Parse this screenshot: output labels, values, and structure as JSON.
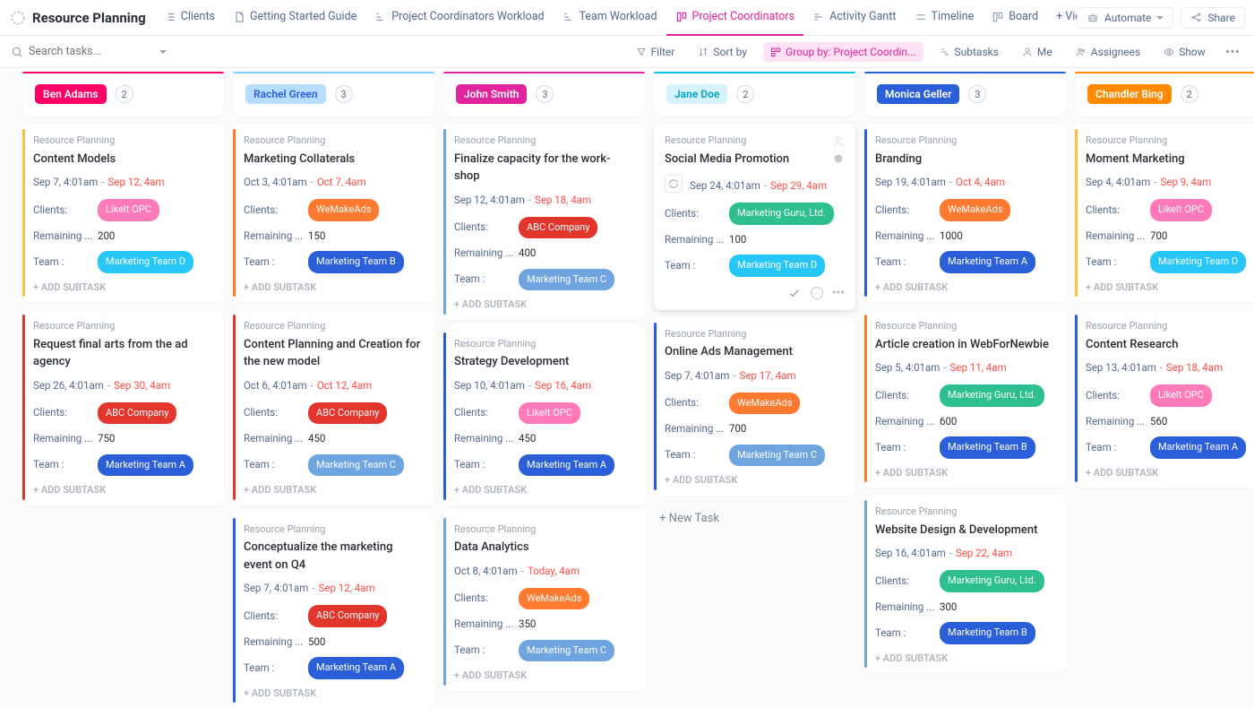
{
  "header": {
    "title": "Resource Planning",
    "tabs": [
      {
        "label": "Clients",
        "icon": "list"
      },
      {
        "label": "Getting Started Guide",
        "icon": "doc"
      },
      {
        "label": "Project Coordinators Workload",
        "icon": "workload"
      },
      {
        "label": "Team Workload",
        "icon": "workload"
      },
      {
        "label": "Project Coordinators",
        "icon": "board",
        "active": true
      },
      {
        "label": "Activity Gantt",
        "icon": "gantt"
      },
      {
        "label": "Timeline",
        "icon": "timeline"
      },
      {
        "label": "Board",
        "icon": "board"
      },
      {
        "label": "+ View",
        "icon": ""
      }
    ],
    "automate": "Automate",
    "share": "Share"
  },
  "filters": {
    "search_placeholder": "Search tasks...",
    "filter": "Filter",
    "sortby": "Sort by",
    "groupby": "Group by: Project Coordin...",
    "subtasks": "Subtasks",
    "me": "Me",
    "assignees": "Assignees",
    "show": "Show"
  },
  "labels": {
    "project": "Resource Planning",
    "clients": "Clients:",
    "remaining": "Remaining ...",
    "team": "Team :",
    "addsub": "+ ADD SUBTASK",
    "newtask": "+ New Task"
  },
  "tag_colors": {
    "LikeIt OPC": "#ff7ab8",
    "WeMakeAds": "#ff7a2f",
    "ABC Company": "#e2362c",
    "Marketing Guru, Ltd.": "#2dc08d",
    "Marketing Team A": "#2b5fd9",
    "Marketing Team B": "#2b5fd9",
    "Marketing Team C": "#6ea4df",
    "Marketing Team D": "#26c6f9"
  },
  "columns": [
    {
      "name": "Ben Adams",
      "count": 2,
      "strip": "#ff0066",
      "badge_bg": "#ff0066",
      "badge_fg": "#ffffff",
      "cards": [
        {
          "strip": "#f5c242",
          "title": "Content Models",
          "d1": "Sep 7, 4:01am",
          "d2": "Sep 12, 4am",
          "client": "LikeIt OPC",
          "remaining": "200",
          "team": "Marketing Team D"
        },
        {
          "strip": "#e2362c",
          "title": "Request final arts from the ad agency",
          "d1": "Sep 26, 4:01am",
          "d2": "Sep 30, 4am",
          "client": "ABC Company",
          "remaining": "750",
          "team": "Marketing Team A"
        }
      ]
    },
    {
      "name": "Rachel Green",
      "count": 3,
      "strip": "#7fd4ff",
      "badge_bg": "#b7ddff",
      "badge_fg": "#2b5fd9",
      "cards": [
        {
          "strip": "#ff7a2f",
          "title": "Marketing Collaterals",
          "d1": "Oct 3, 4:01am",
          "d2": "Oct 7, 4am",
          "client": "WeMakeAds",
          "remaining": "150",
          "team": "Marketing Team B"
        },
        {
          "strip": "#e2362c",
          "title": "Content Planning and Creation for the new model",
          "d1": "Oct 6, 4:01am",
          "d2": "Oct 12, 4am",
          "client": "ABC Company",
          "remaining": "450",
          "team": "Marketing Team C"
        },
        {
          "strip": "#2b5fd9",
          "title": "Conceptualize the marketing event on Q4",
          "d1": "Sep 7, 4:01am",
          "d2": "Sep 12, 4am",
          "client": "ABC Company",
          "remaining": "500",
          "team": "Marketing Team A"
        }
      ]
    },
    {
      "name": "John Smith",
      "count": 3,
      "strip": "#e2239e",
      "badge_bg": "#e2239e",
      "badge_fg": "#ffffff",
      "cards": [
        {
          "strip": "#6ea4df",
          "title": "Finalize capacity for the work-shop",
          "d1": "Sep 12, 4:01am",
          "d2": "Sep 18, 4am",
          "client": "ABC Company",
          "remaining": "400",
          "team": "Marketing Team C"
        },
        {
          "strip": "#2b5fd9",
          "title": "Strategy Development",
          "d1": "Sep 10, 4:01am",
          "d2": "Sep 16, 4am",
          "client": "LikeIt OPC",
          "remaining": "450",
          "team": "Marketing Team A"
        },
        {
          "strip": "#6ea4df",
          "title": "Data Analytics",
          "d1": "Oct 8, 4:01am",
          "d2": "Today, 4am",
          "client": "WeMakeAds",
          "remaining": "350",
          "team": "Marketing Team C"
        }
      ]
    },
    {
      "name": "Jane Doe",
      "count": 2,
      "strip": "#00c4e8",
      "badge_bg": "#d5f3f8",
      "badge_fg": "#00a3c4",
      "cards": [
        {
          "strip": "#ffffff",
          "hover": true,
          "recur": true,
          "title": "Social Media Promotion",
          "d1": "Sep 24, 4:01am",
          "d2": "Sep 29, 4am",
          "client": "Marketing Guru, Ltd.",
          "remaining": "100",
          "team": "Marketing Team D"
        },
        {
          "strip": "#2b5fd9",
          "title": "Online Ads Management",
          "d1": "Sep 7, 4:01am",
          "d2": "Sep 17, 4am",
          "client": "WeMakeAds",
          "remaining": "700",
          "team": "Marketing Team C"
        }
      ],
      "show_new_task": true
    },
    {
      "name": "Monica Geller",
      "count": 3,
      "strip": "#2b5fd9",
      "badge_bg": "#2b5fd9",
      "badge_fg": "#ffffff",
      "cards": [
        {
          "strip": "#2b5fd9",
          "title": "Branding",
          "d1": "Sep 19, 4:01am",
          "d2": "Oct 4, 4am",
          "client": "WeMakeAds",
          "remaining": "1000",
          "team": "Marketing Team A"
        },
        {
          "strip": "#ff7a2f",
          "title": "Article creation in WebForNewbie",
          "d1": "Sep 5, 4:01am",
          "d2": "Sep 11, 4am",
          "client": "Marketing Guru, Ltd.",
          "remaining": "600",
          "team": "Marketing Team B"
        },
        {
          "strip": "#6ea4df",
          "title": "Website Design & Development",
          "d1": "Sep 16, 4:01am",
          "d2": "Sep 22, 4am",
          "client": "Marketing Guru, Ltd.",
          "remaining": "300",
          "team": "Marketing Team B"
        }
      ]
    },
    {
      "name": "Chandler Bing",
      "count": 2,
      "strip": "#ff8a00",
      "badge_bg": "#ff8a00",
      "badge_fg": "#ffffff",
      "cards": [
        {
          "strip": "#f5c242",
          "title": "Moment Marketing",
          "d1": "Sep 4, 4:01am",
          "d2": "Sep 9, 4am",
          "client": "LikeIt OPC",
          "remaining": "700",
          "team": "Marketing Team D"
        },
        {
          "strip": "#2b5fd9",
          "title": "Content Research",
          "d1": "Sep 13, 4:01am",
          "d2": "Sep 18, 4am",
          "client": "LikeIt OPC",
          "remaining": "560",
          "team": "Marketing Team A"
        }
      ]
    }
  ]
}
